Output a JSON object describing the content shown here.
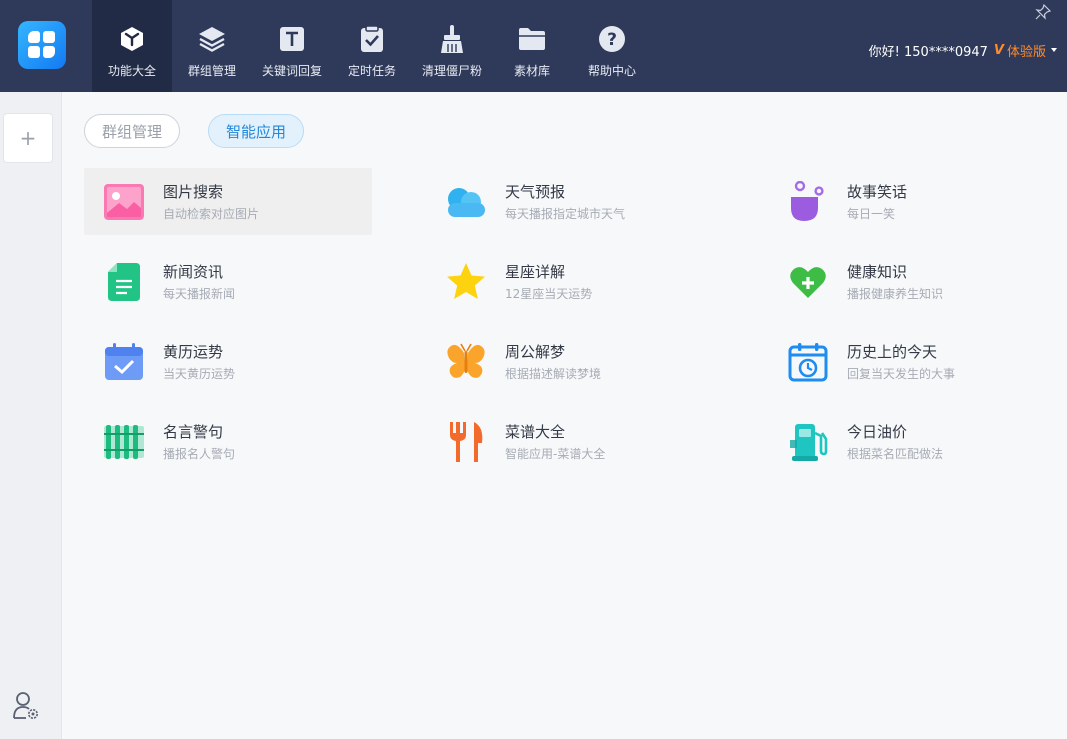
{
  "nav": [
    {
      "label": "功能大全",
      "icon": "cube-icon",
      "active": true
    },
    {
      "label": "群组管理",
      "icon": "layers-icon"
    },
    {
      "label": "关键词回复",
      "icon": "keyword-t-icon"
    },
    {
      "label": "定时任务",
      "icon": "clipboard-check-icon"
    },
    {
      "label": "清理僵尸粉",
      "icon": "broom-icon"
    },
    {
      "label": "素材库",
      "icon": "folder-icon"
    },
    {
      "label": "帮助中心",
      "icon": "help-circle-icon"
    }
  ],
  "user": {
    "greeting": "你好! 150****0947",
    "trial_label": "体验版",
    "trial_mark": "V"
  },
  "sidebar": {
    "add_label": "+"
  },
  "tabs": [
    {
      "label": "群组管理",
      "active": false
    },
    {
      "label": "智能应用",
      "active": true
    }
  ],
  "apps": [
    {
      "title": "图片搜索",
      "desc": "自动检索对应图片",
      "icon": "image-icon"
    },
    {
      "title": "天气预报",
      "desc": "每天播报指定城市天气",
      "icon": "cloud-icon"
    },
    {
      "title": "故事笑话",
      "desc": "每日一笑",
      "icon": "bubbles-icon"
    },
    {
      "title": "新闻资讯",
      "desc": "每天播报新闻",
      "icon": "news-icon"
    },
    {
      "title": "星座详解",
      "desc": "12星座当天运势",
      "icon": "star-icon"
    },
    {
      "title": "健康知识",
      "desc": "播报健康养生知识",
      "icon": "heart-plus-icon"
    },
    {
      "title": "黄历运势",
      "desc": "当天黄历运势",
      "icon": "calendar-check-icon"
    },
    {
      "title": "周公解梦",
      "desc": "根据描述解读梦境",
      "icon": "butterfly-icon"
    },
    {
      "title": "历史上的今天",
      "desc": "回复当天发生的大事",
      "icon": "calendar-history-icon"
    },
    {
      "title": "名言警句",
      "desc": "播报名人警句",
      "icon": "bamboo-scroll-icon"
    },
    {
      "title": "菜谱大全",
      "desc": "智能应用-菜谱大全",
      "icon": "fork-knife-icon"
    },
    {
      "title": "今日油价",
      "desc": "根据菜名匹配做法",
      "icon": "gas-pump-icon"
    }
  ]
}
